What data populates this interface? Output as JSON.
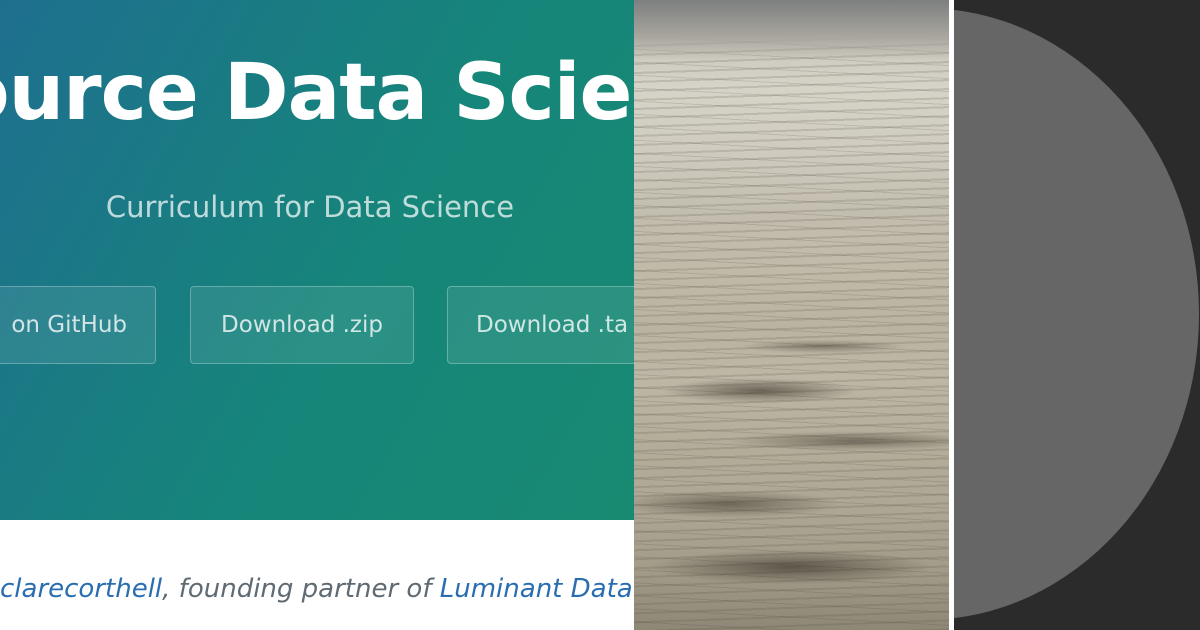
{
  "hero": {
    "title": "ource Data Scien",
    "tagline": "Curriculum for Data Science",
    "buttons": {
      "github": "on GitHub",
      "zip": "Download .zip",
      "tar": "Download .ta"
    }
  },
  "footer": {
    "author": "clarecorthell",
    "middle": ", founding partner of ",
    "org": "Luminant Data"
  },
  "colors": {
    "hero_gradient_start": "#1e6f8f",
    "hero_gradient_end": "#188a72",
    "link": "#2a6db0",
    "dark_panel": "#2b2b2b",
    "circle": "#666666"
  }
}
